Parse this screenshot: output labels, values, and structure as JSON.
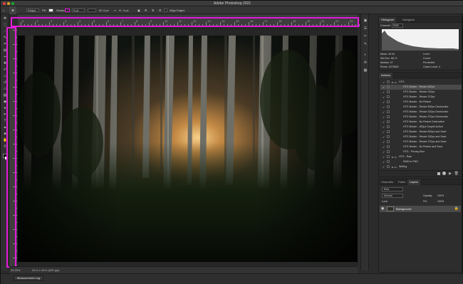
{
  "window": {
    "title": "Adobe Photoshop 2021"
  },
  "options_bar": {
    "shape_label": "Shape",
    "fill_label": "Fill:",
    "stroke_label": "Stroke:",
    "stroke_width": "3 px",
    "w_label": "W:",
    "w_value": "0 px",
    "h_label": "H:",
    "h_value": "0 px",
    "align_edges_label": "Align Edges",
    "colors": {
      "fill": "#e31bd9",
      "stroke": "#e31bd9"
    }
  },
  "ruler": {
    "h_ticks": [
      "0",
      "1",
      "2",
      "3",
      "4",
      "5",
      "6",
      "7",
      "8",
      "9",
      "10",
      "11",
      "12",
      "13",
      "14",
      "15",
      "16",
      "17",
      "18",
      "19",
      "20",
      "21",
      "22",
      "23"
    ]
  },
  "statusbar": {
    "zoom": "33.33%",
    "doc": "24 in x 16 in (300 ppi)"
  },
  "bottom": {
    "measurement_log": "Measurement Log"
  },
  "histogram_panel": {
    "tabs": [
      "Histogram",
      "Navigator"
    ],
    "channel_label": "Channel:",
    "channel_value": "RGB",
    "stats": [
      {
        "label": "Mean:",
        "value": "49.44"
      },
      {
        "label": "Std Dev:",
        "value": "58.71"
      },
      {
        "label": "Median:",
        "value": "27"
      },
      {
        "label": "Pixels:",
        "value": "2073600"
      }
    ],
    "stats_right": [
      "Level:",
      "Count:",
      "Percentile:",
      "Cache Level: 4"
    ]
  },
  "actions_panel": {
    "tabs": [
      "Actions"
    ],
    "items": [
      {
        "label": "HTG",
        "folder": true,
        "checked": true,
        "indent": 0
      },
      {
        "label": "HTG Border - Resize 820px",
        "checked": true,
        "indent": 1,
        "selected": true
      },
      {
        "label": "HTG Border - Resize 320px",
        "checked": true,
        "indent": 1
      },
      {
        "label": "HTG Border - Resize 370px",
        "checked": true,
        "indent": 1
      },
      {
        "label": "HTG Border - No Resize",
        "checked": true,
        "indent": 1
      },
      {
        "label": "HTG Border - Resize 820px Destructive",
        "checked": true,
        "indent": 1
      },
      {
        "label": "HTG Border - Resize 320px Destructive",
        "checked": true,
        "indent": 1
      },
      {
        "label": "HTG Border - Resize 370px Destructive",
        "checked": true,
        "indent": 1
      },
      {
        "label": "HTG Border - No Resize Destructive",
        "checked": true,
        "indent": 1
      },
      {
        "label": "HTG Border - 820px Droplet Action",
        "checked": true,
        "indent": 1
      },
      {
        "label": "HTG Border - Resize 820px and Save",
        "checked": true,
        "indent": 1
      },
      {
        "label": "HTG Border - Resize 320px and Save",
        "checked": true,
        "indent": 1
      },
      {
        "label": "HTG Border - Resize 370px and Save",
        "checked": true,
        "indent": 1
      },
      {
        "label": "HTG Border - No Resize and Save",
        "checked": true,
        "indent": 1
      },
      {
        "label": "HTG - Privacy Blur",
        "checked": true,
        "indent": 1
      },
      {
        "label": "HTG - Raw",
        "folder": true,
        "checked": true,
        "indent": 0
      },
      {
        "label": "RAW to PNG",
        "checked": true,
        "indent": 1
      },
      {
        "label": "Writing",
        "folder": true,
        "checked": true,
        "indent": 0
      }
    ]
  },
  "layers_panel": {
    "tabs": [
      "Channels",
      "Paths",
      "Layers"
    ],
    "kind_label": "Kind",
    "blend_mode": "Normal",
    "opacity_label": "Opacity:",
    "opacity_value": "100%",
    "lock_label": "Lock:",
    "fill_label": "Fill:",
    "fill_value": "100%",
    "layer_name": "Background"
  }
}
